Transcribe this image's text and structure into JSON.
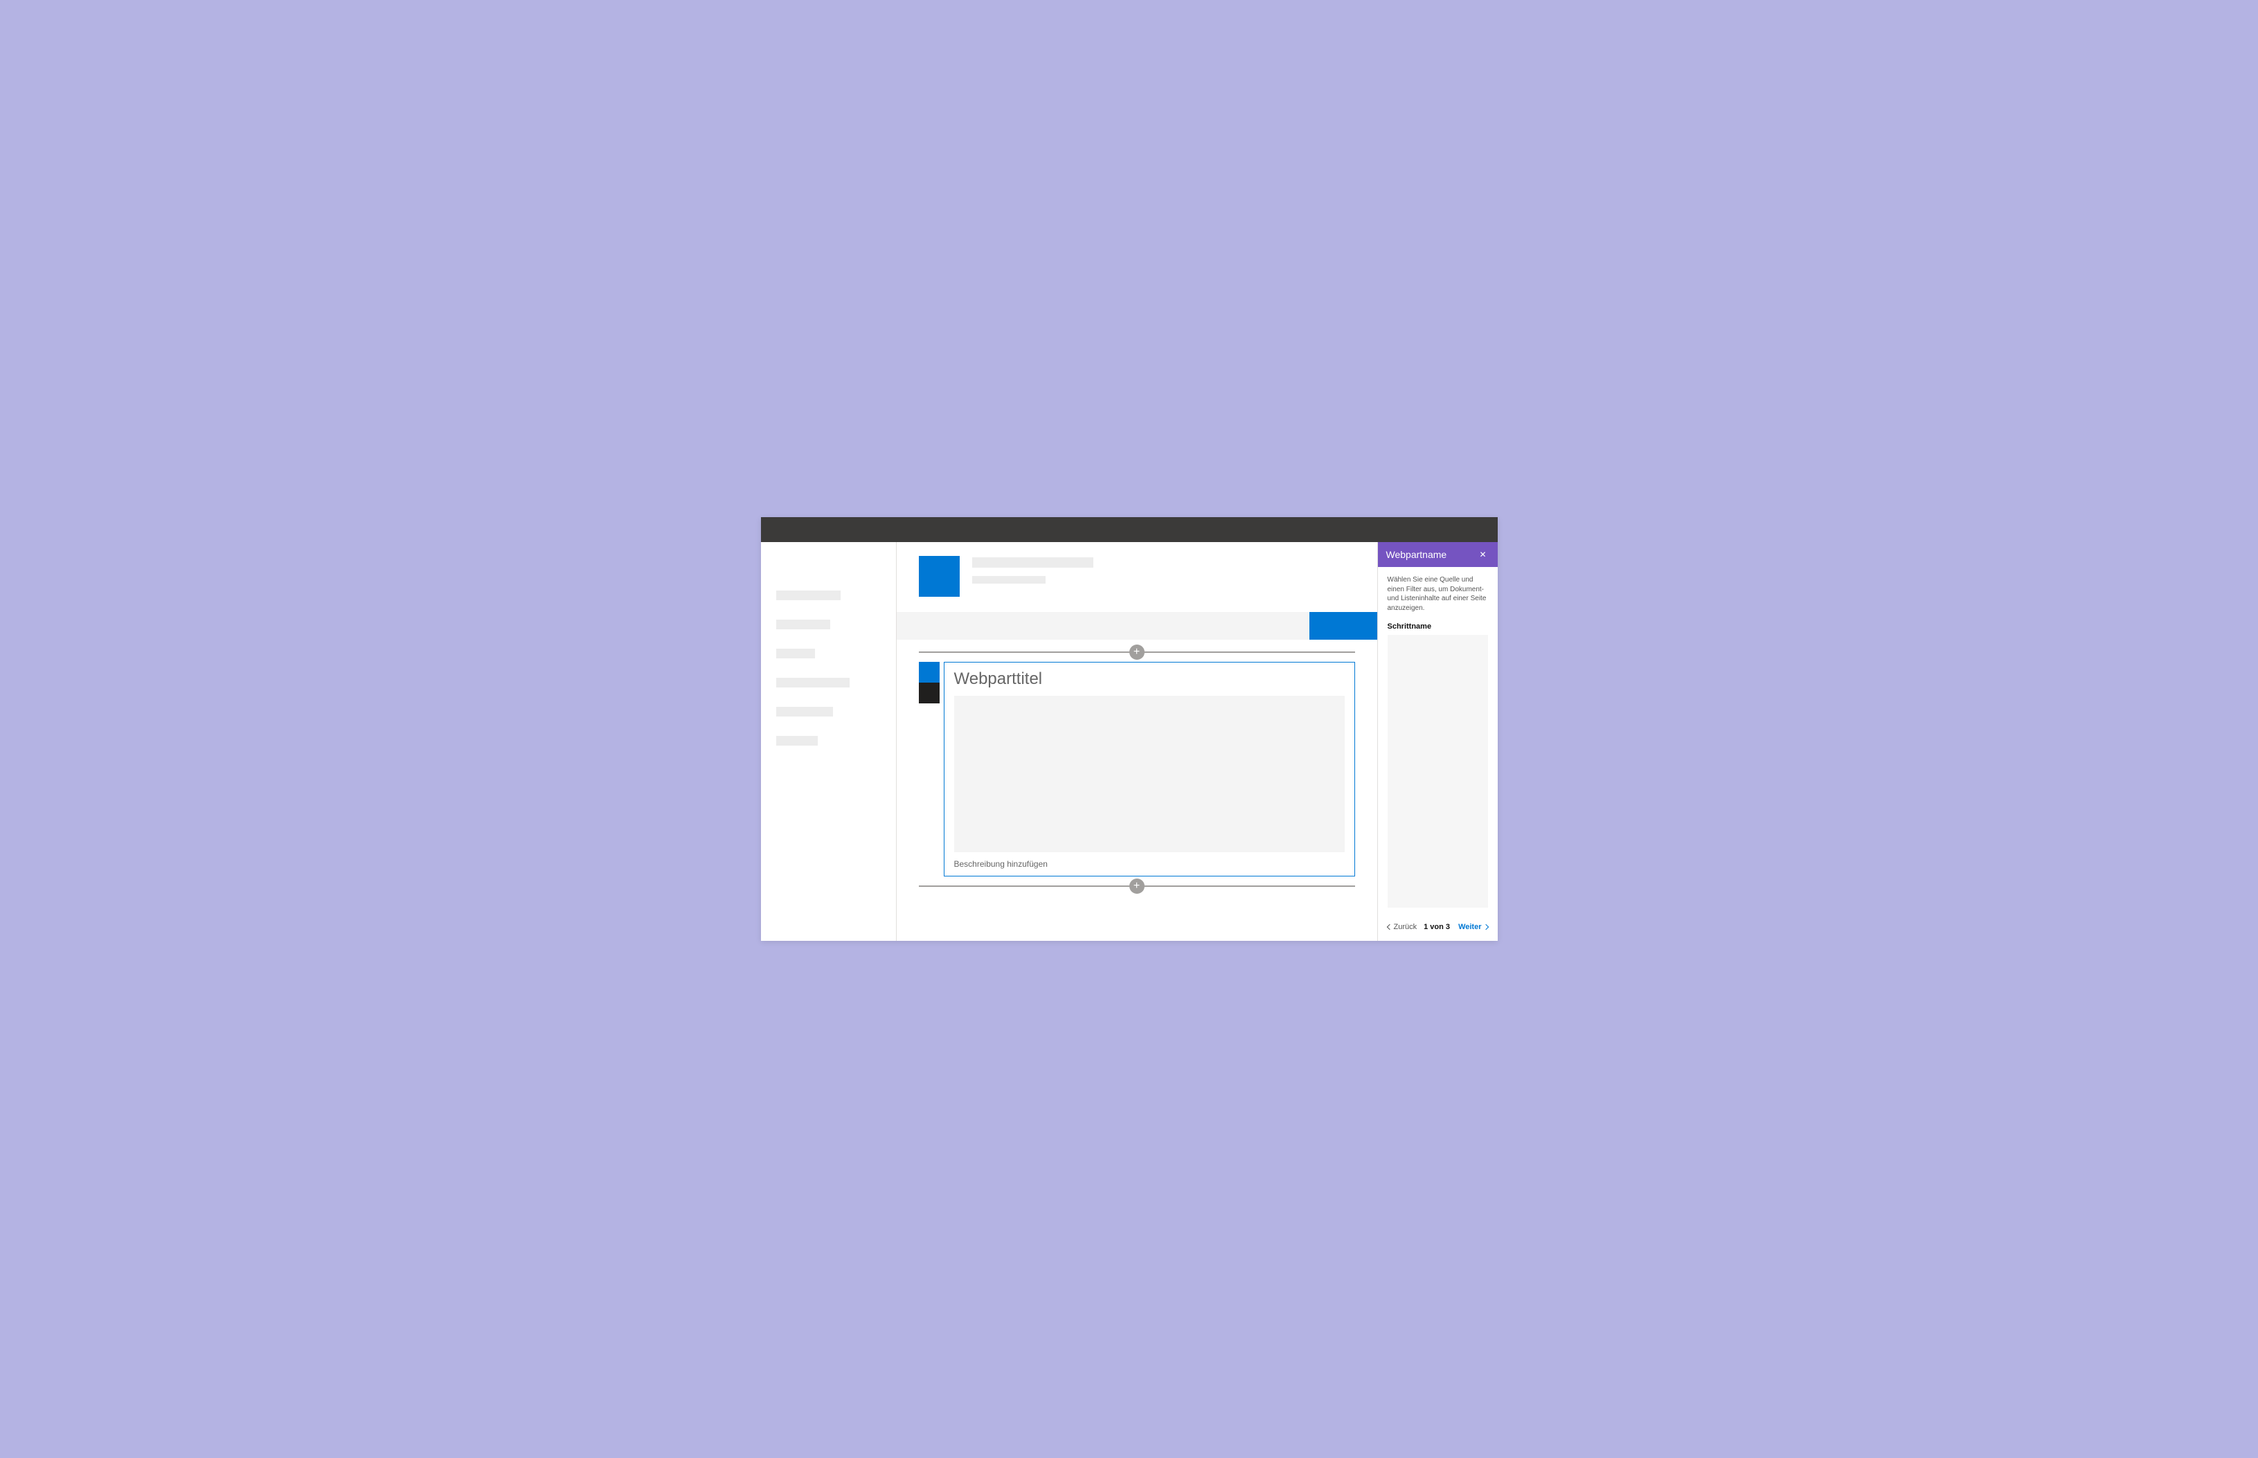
{
  "colors": {
    "background": "#b4b3e3",
    "titlebar": "#3b3a39",
    "accent": "#0078d4",
    "panel_accent": "#7554c1"
  },
  "webpart": {
    "title_placeholder": "Webparttitel",
    "caption_placeholder": "Beschreibung hinzufügen"
  },
  "panel": {
    "title": "Webpartname",
    "description": "Wählen Sie eine Quelle und einen Filter aus, um Dokument- und Listeninhalte auf einer Seite anzuzeigen.",
    "step_label": "Schrittname",
    "back_label": "Zurück",
    "next_label": "Weiter",
    "page_indicator": "1 von 3"
  }
}
